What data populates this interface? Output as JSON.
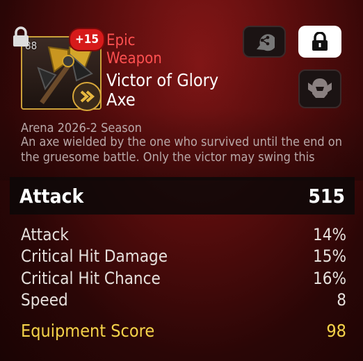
{
  "item": {
    "level": "88",
    "enhance": "+15",
    "rarity_line1": "Epic",
    "rarity_line2": "Weapon",
    "name_line1": "Victor of Glory",
    "name_line2": "Axe",
    "season": "Arena 2026-2 Season",
    "description": "An axe wielded by the one who survived until the end on the gruesome battle. Only the victor may swing this weapon."
  },
  "main_stat": {
    "label": "Attack",
    "value": "515"
  },
  "substats": [
    {
      "label": "Attack",
      "value": "14%"
    },
    {
      "label": "Critical Hit Damage",
      "value": "15%"
    },
    {
      "label": "Critical Hit Chance",
      "value": "16%"
    },
    {
      "label": "Speed",
      "value": "8"
    }
  ],
  "score": {
    "label": "Equipment Score",
    "value": "98"
  },
  "colors": {
    "rarity": "#ff5050",
    "score": "#f5d34a",
    "enhance_badge": "#d61a1a",
    "frame_gold": "#caa13a"
  },
  "icons": {
    "share": "share-icon",
    "lock": "lock-icon",
    "role": "warrior-class-icon",
    "item_lock": "lock-icon",
    "set": "set-icon"
  }
}
